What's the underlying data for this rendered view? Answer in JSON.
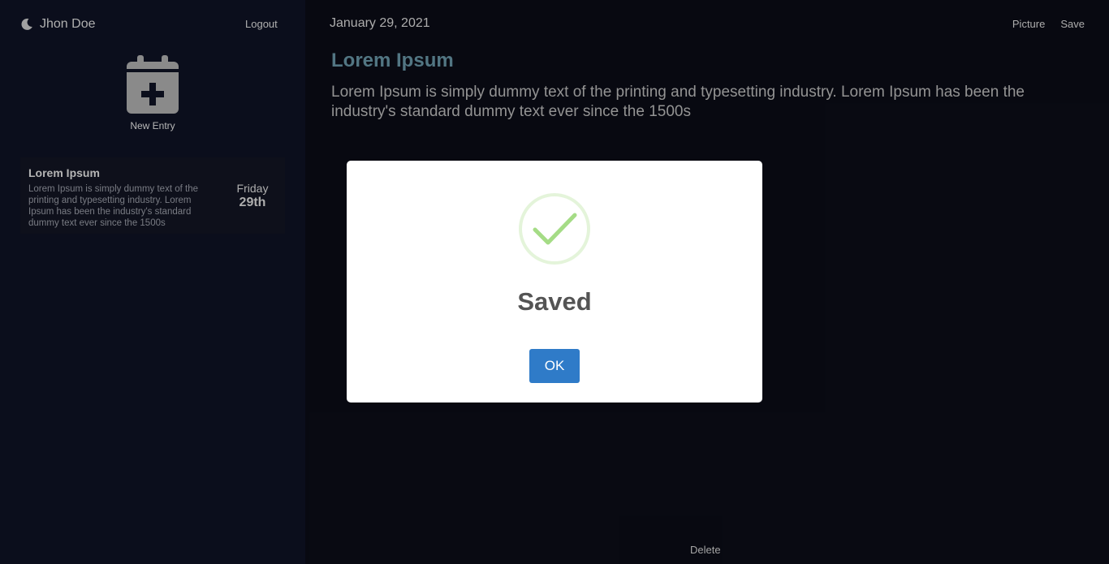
{
  "sidebar": {
    "user_name": "Jhon Doe",
    "logout_label": "Logout",
    "new_entry_label": "New Entry",
    "entries": [
      {
        "title": "Lorem Ipsum",
        "excerpt": "Lorem Ipsum is simply dummy text of the printing and typesetting industry. Lorem Ipsum has been the industry's standard dummy text ever since the 1500s",
        "day": "Friday",
        "date": "29th"
      }
    ]
  },
  "main": {
    "date": "January 29, 2021",
    "picture_label": "Picture",
    "save_label": "Save",
    "title": "Lorem Ipsum",
    "body": "Lorem Ipsum is simply dummy text of the printing and typesetting industry. Lorem Ipsum has been the industry's standard dummy text ever since the 1500s",
    "delete_label": "Delete"
  },
  "modal": {
    "title": "Saved",
    "ok_label": "OK",
    "icon": "check-circle-icon"
  },
  "colors": {
    "accent_title": "#5e8796",
    "ok_button": "#2f7bc8",
    "success_check": "#a5dc86"
  }
}
